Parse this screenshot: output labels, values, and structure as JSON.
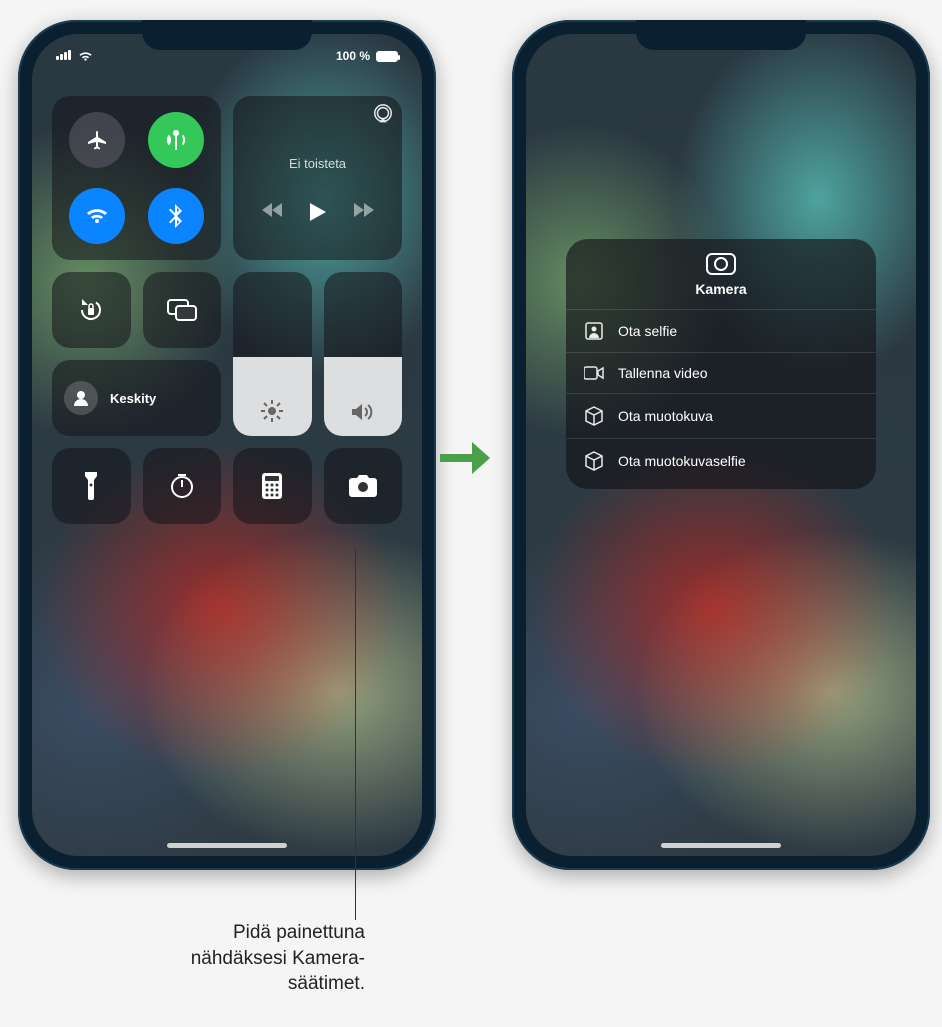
{
  "statusbar": {
    "battery_label": "100 %"
  },
  "control_center": {
    "toggles": {
      "airplane": "airplane-mode",
      "cellular": "cellular-data",
      "wifi": "wifi",
      "bluetooth": "bluetooth"
    },
    "playback": {
      "title": "Ei toisteta"
    },
    "buttons": {
      "orientation_lock": "orientation-lock",
      "screen_mirroring": "screen-mirroring",
      "focus_label": "Keskity",
      "flashlight": "flashlight",
      "timer": "timer",
      "calculator": "calculator",
      "camera": "camera"
    },
    "sliders": {
      "brightness_pct": 48,
      "volume_pct": 48
    }
  },
  "camera_menu": {
    "title": "Kamera",
    "items": [
      {
        "icon": "person-square",
        "label": "Ota selfie"
      },
      {
        "icon": "video",
        "label": "Tallenna video"
      },
      {
        "icon": "cube",
        "label": "Ota muotokuva"
      },
      {
        "icon": "cube",
        "label": "Ota muotokuvaselfie"
      }
    ]
  },
  "callout": {
    "text": "Pidä painettuna nähdäksesi Kamera-säätimet."
  }
}
